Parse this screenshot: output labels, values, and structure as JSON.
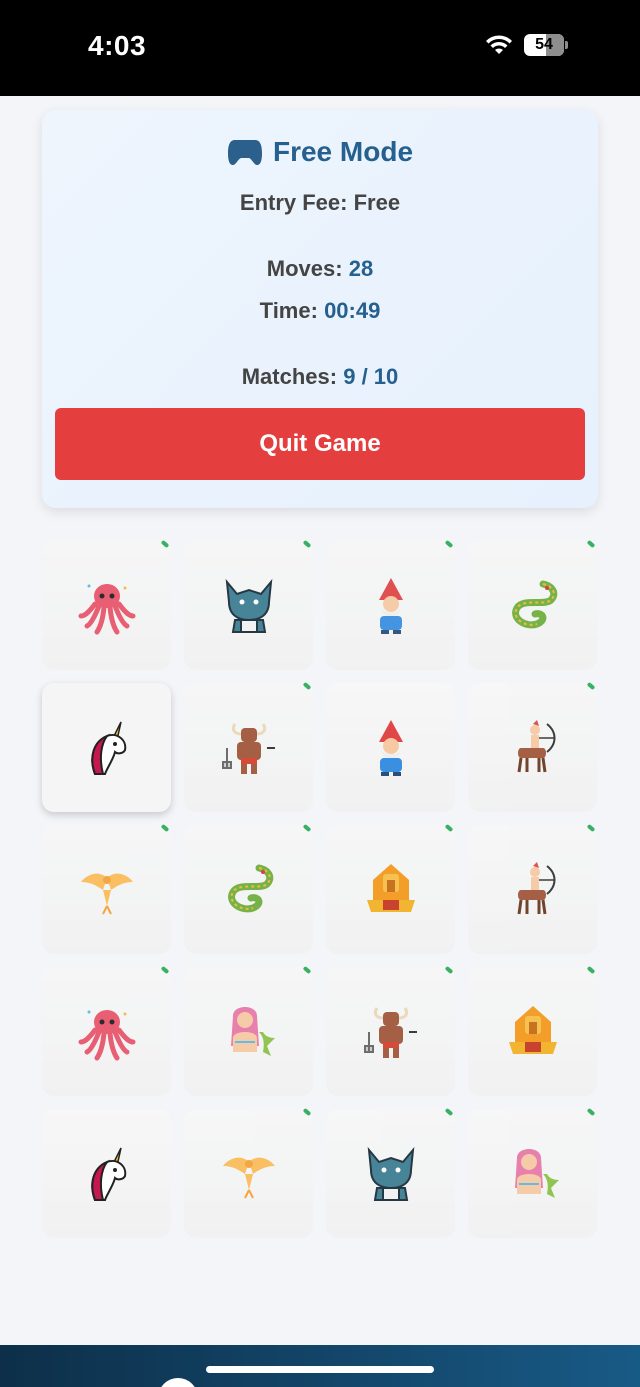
{
  "status_bar": {
    "time": "4:03",
    "battery": "54",
    "battery_level": 0.54
  },
  "game_info": {
    "mode_icon": "gamepad-icon",
    "mode_title": "Free Mode",
    "entry_fee_label": "Entry Fee:",
    "entry_fee_value": "Free",
    "moves_label": "Moves:",
    "moves_value": "28",
    "time_label": "Time:",
    "time_value": "00:49",
    "matches_label": "Matches:",
    "matches_value": "9 / 10",
    "quit_label": "Quit Game",
    "accent_color": "#25608f",
    "quit_color": "#e53e3e"
  },
  "board": {
    "columns": 4,
    "rows": 5,
    "cards": [
      {
        "creature": "octopus-icon",
        "matched": true
      },
      {
        "creature": "werewolf-icon",
        "matched": true
      },
      {
        "creature": "gnome-icon",
        "matched": true
      },
      {
        "creature": "dragon-icon",
        "matched": true
      },
      {
        "creature": "unicorn-icon",
        "matched": false,
        "flipped": true
      },
      {
        "creature": "minotaur-icon",
        "matched": true
      },
      {
        "creature": "gnome-icon",
        "matched": false
      },
      {
        "creature": "centaur-icon",
        "matched": true
      },
      {
        "creature": "phoenix-icon",
        "matched": true
      },
      {
        "creature": "dragon-icon",
        "matched": true
      },
      {
        "creature": "sphinx-icon",
        "matched": true
      },
      {
        "creature": "centaur-icon",
        "matched": true
      },
      {
        "creature": "octopus-icon",
        "matched": true
      },
      {
        "creature": "mermaid-icon",
        "matched": true
      },
      {
        "creature": "minotaur-icon",
        "matched": true
      },
      {
        "creature": "sphinx-icon",
        "matched": true
      },
      {
        "creature": "unicorn-icon",
        "matched": false
      },
      {
        "creature": "phoenix-icon",
        "matched": true
      },
      {
        "creature": "werewolf-icon",
        "matched": true
      },
      {
        "creature": "mermaid-icon",
        "matched": true
      }
    ]
  }
}
